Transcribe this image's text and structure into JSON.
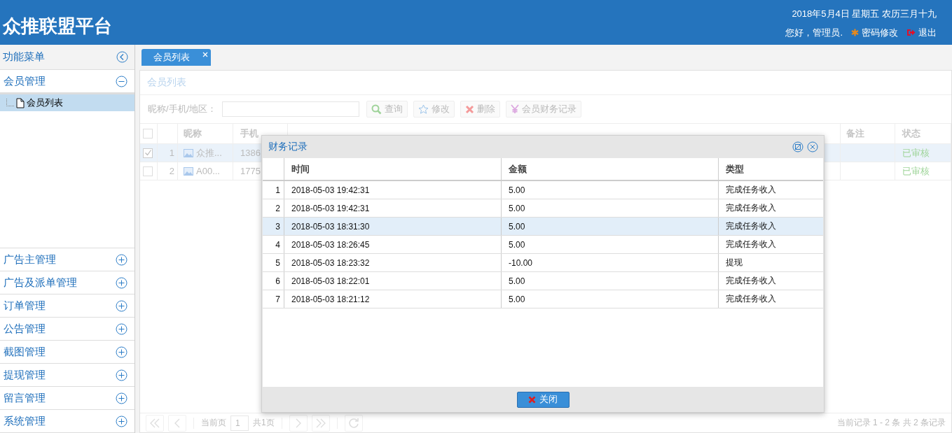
{
  "header": {
    "title": "众推联盟平台",
    "date": "2018年5月4日 星期五 农历三月十九",
    "greeting": "您好，管理员.",
    "password_link": "密码修改",
    "logout_link": "退出"
  },
  "sidebar": {
    "title": "功能菜单",
    "panels": [
      {
        "label": "会员管理",
        "expanded": true,
        "items": [
          {
            "label": "会员列表",
            "selected": true
          }
        ]
      },
      {
        "label": "广告主管理",
        "expanded": false
      },
      {
        "label": "广告及派单管理",
        "expanded": false
      },
      {
        "label": "订单管理",
        "expanded": false
      },
      {
        "label": "公告管理",
        "expanded": false
      },
      {
        "label": "截图管理",
        "expanded": false
      },
      {
        "label": "提现管理",
        "expanded": false
      },
      {
        "label": "留言管理",
        "expanded": false
      },
      {
        "label": "系统管理",
        "expanded": false
      }
    ]
  },
  "tabs": [
    {
      "label": "会员列表",
      "selected": true
    }
  ],
  "panel_title": "会员列表",
  "search": {
    "label": "昵称/手机/地区："
  },
  "toolbar": [
    {
      "kind": "search",
      "label": "查询"
    },
    {
      "kind": "edit",
      "label": "修改"
    },
    {
      "kind": "delete",
      "label": "删除"
    },
    {
      "kind": "finance",
      "label": "会员财务记录"
    }
  ],
  "grid": {
    "all_checked": false,
    "columns": [
      {
        "label": "昵称"
      },
      {
        "label": "手机"
      },
      {
        "label": "备注"
      },
      {
        "label": "状态"
      }
    ],
    "rows": [
      {
        "selected": true,
        "index": "1",
        "nickname": "众推...",
        "phone": "1386",
        "status": "已审核"
      },
      {
        "selected": false,
        "index": "2",
        "nickname": "A00...",
        "phone": "1775",
        "status": "已审核"
      }
    ]
  },
  "pager": {
    "page_label": "当前页",
    "page": "1",
    "total_pages": "共1页",
    "summary": "当前记录 1 - 2 条 共 2 条记录"
  },
  "dialog": {
    "title": "财务记录",
    "columns": [
      "时间",
      "金额",
      "类型"
    ],
    "rows": [
      {
        "index": "1",
        "time": "2018-05-03 19:42:31",
        "amount": "5.00",
        "type": "完成任务收入",
        "selected": false
      },
      {
        "index": "2",
        "time": "2018-05-03 19:42:31",
        "amount": "5.00",
        "type": "完成任务收入",
        "selected": false
      },
      {
        "index": "3",
        "time": "2018-05-03 18:31:30",
        "amount": "5.00",
        "type": "完成任务收入",
        "selected": true
      },
      {
        "index": "4",
        "time": "2018-05-03 18:26:45",
        "amount": "5.00",
        "type": "完成任务收入",
        "selected": false
      },
      {
        "index": "5",
        "time": "2018-05-03 18:23:32",
        "amount": "-10.00",
        "type": "提现",
        "selected": false
      },
      {
        "index": "6",
        "time": "2018-05-03 18:22:01",
        "amount": "5.00",
        "type": "完成任务收入",
        "selected": false
      },
      {
        "index": "7",
        "time": "2018-05-03 18:21:12",
        "amount": "5.00",
        "type": "完成任务收入",
        "selected": false
      }
    ],
    "close_button": "关闭"
  }
}
